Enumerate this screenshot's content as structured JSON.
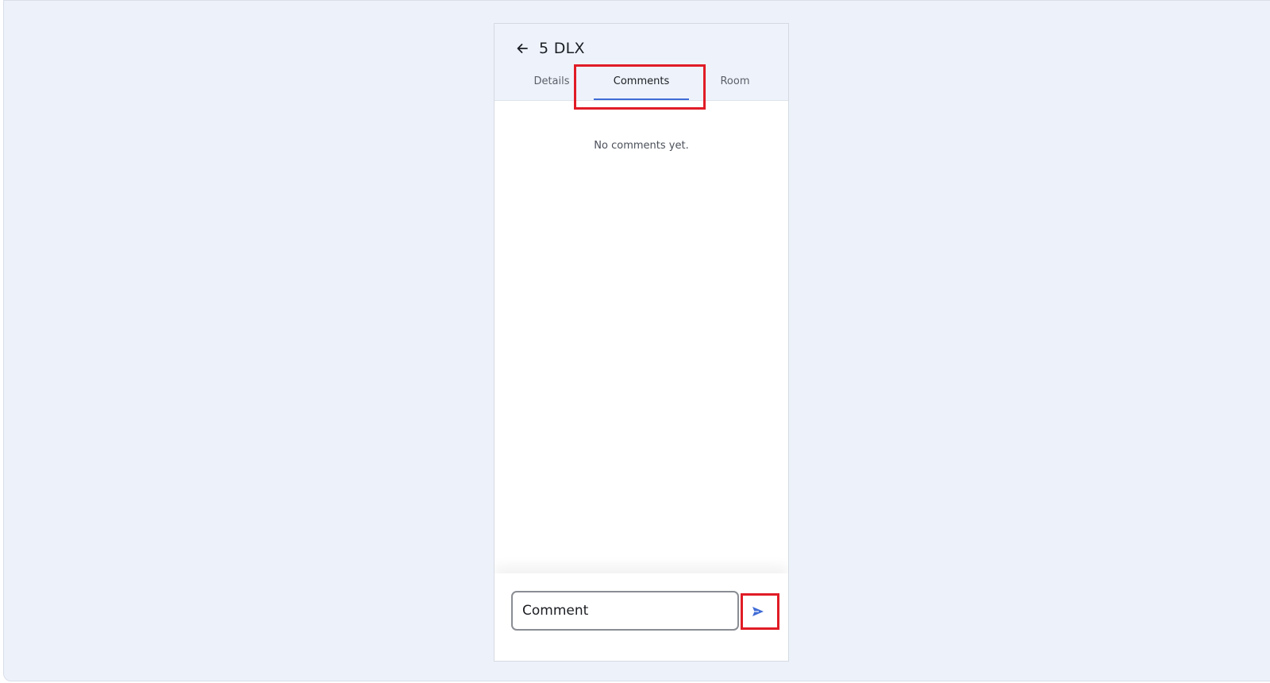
{
  "header": {
    "title": "5 DLX",
    "back_icon": "arrow-left-icon"
  },
  "tabs": [
    {
      "label": "Details",
      "active": false
    },
    {
      "label": "Comments",
      "active": true
    },
    {
      "label": "Room",
      "active": false
    }
  ],
  "comments": {
    "empty_message": "No comments yet."
  },
  "composer": {
    "input_value": "Comment",
    "send_icon": "send-icon",
    "accent_color": "#3f6bd6"
  },
  "annotations": {
    "highlight_color": "#e01c26"
  }
}
